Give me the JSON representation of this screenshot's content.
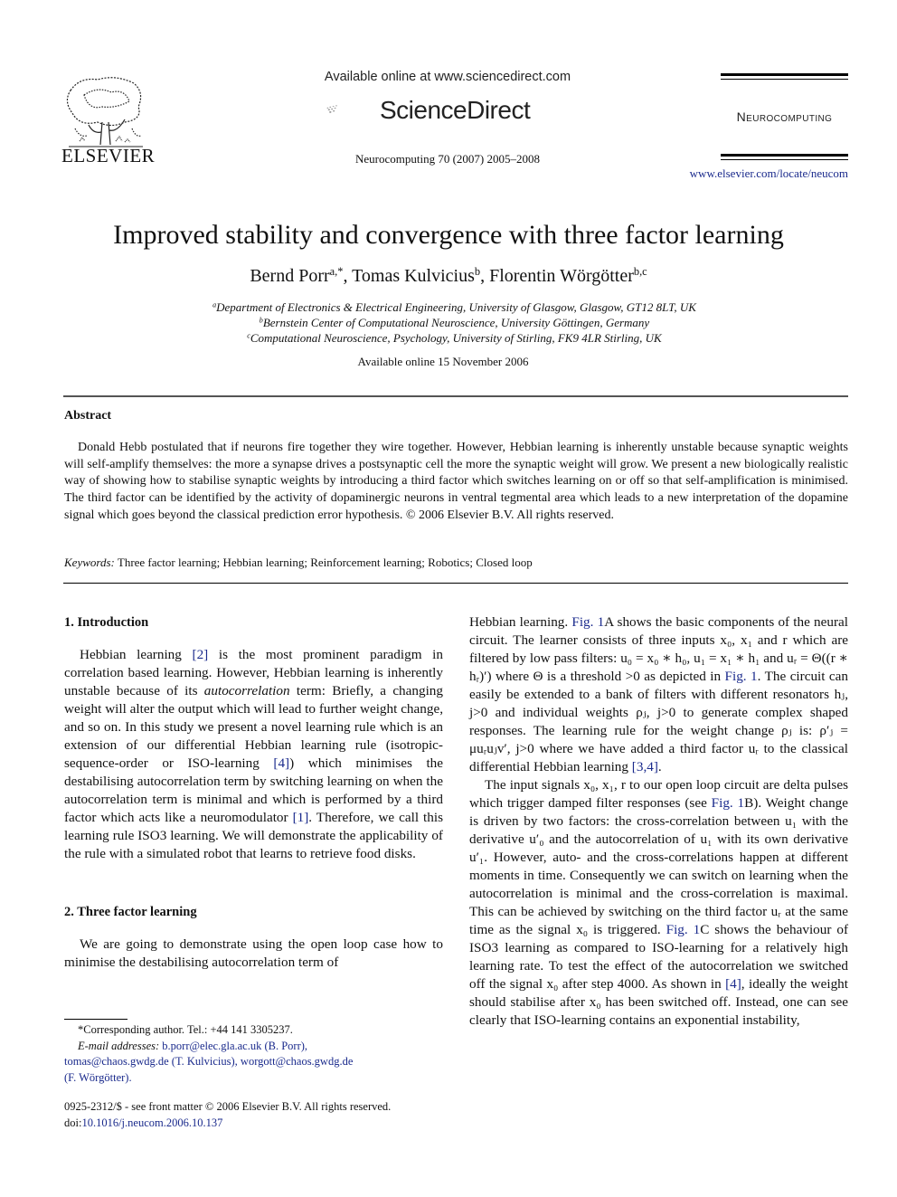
{
  "header": {
    "publisher_logo_word": "ELSEVIER",
    "sd_available": "Available online at www.sciencedirect.com",
    "sd_brand": "ScienceDirect",
    "journal_ref": "Neurocomputing 70 (2007) 2005–2008",
    "journal_name": "Neurocomputing",
    "journal_url": "www.elsevier.com/locate/neucom"
  },
  "article": {
    "title": "Improved stability and convergence with three factor learning",
    "authors": [
      {
        "name": "Bernd Porr",
        "sup": "a,*"
      },
      {
        "name": "Tomas Kulvicius",
        "sup": "b"
      },
      {
        "name": "Florentin Wörgötter",
        "sup": "b,c"
      }
    ],
    "author_sep": ", ",
    "affiliations": [
      {
        "sup": "a",
        "text": "Department of Electronics & Electrical Engineering, University of Glasgow, Glasgow, GT12 8LT, UK"
      },
      {
        "sup": "b",
        "text": "Bernstein Center of Computational Neuroscience, University Göttingen, Germany"
      },
      {
        "sup": "c",
        "text": "Computational Neuroscience, Psychology, University of Stirling, FK9 4LR Stirling, UK"
      }
    ],
    "available_online": "Available online 15 November 2006"
  },
  "abstract": {
    "heading": "Abstract",
    "text": "Donald Hebb postulated that if neurons fire together they wire together. However, Hebbian learning is inherently unstable because synaptic weights will self-amplify themselves: the more a synapse drives a postsynaptic cell the more the synaptic weight will grow. We present a new biologically realistic way of showing how to stabilise synaptic weights by introducing a third factor which switches learning on or off so that self-amplification is minimised. The third factor can be identified by the activity of dopaminergic neurons in ventral tegmental area which leads to a new interpretation of the dopamine signal which goes beyond the classical prediction error hypothesis.",
    "copyright": "© 2006 Elsevier B.V. All rights reserved.",
    "keywords_label": "Keywords:",
    "keywords": "Three factor learning; Hebbian learning; Reinforcement learning; Robotics; Closed loop"
  },
  "sections": {
    "intro_heading": "1.  Introduction",
    "intro": {
      "t1": "Hebbian learning ",
      "ref1": "[2]",
      "t2": " is the most prominent paradigm in correlation based learning. However, Hebbian learning is inherently unstable because of its ",
      "em1": "autocorrelation",
      "t3": " term: Briefly, a changing weight will alter the output which will lead to further weight change, and so on. In this study we present a novel learning rule which is an extension of our differential Hebbian learning rule (isotropic-sequence-order or ISO-learning ",
      "ref2": "[4]",
      "t4": ") which minimises the destabilising autocorrelation term by switching learning on when the autocorrelation term is minimal and which is performed by a third factor which acts like a neuromodulator ",
      "ref3": "[1]",
      "t5": ". Therefore, we call this learning rule ISO3 learning. We will demonstrate the applicability of the rule with a simulated robot that learns to retrieve food disks."
    },
    "tfl_heading": "2.  Three factor learning",
    "tfl_p1": {
      "t1": "We are going to demonstrate using the open loop case how to minimise the destabilising autocorrelation term of Hebbian learning. ",
      "ref1": "Fig. 1",
      "t2": "A shows the basic components of the neural circuit. The learner consists of three inputs x₀, x₁ and r which are filtered by low pass filters: u₀ = x₀ ∗ h₀, u₁ = x₁ ∗ h₁ and uᵣ = Θ((r ∗ hᵣ)′) where Θ is a threshold >0 as depicted in ",
      "ref2": "Fig. 1",
      "t3": ". The circuit can easily be extended to a bank of filters with different resonators hⱼ, j>0 and individual weights ρⱼ, j>0 to generate complex shaped responses. The learning rule for the weight change ρⱼ is: ρ′ⱼ = μuᵣuⱼv′, j>0 where we have added a third factor uᵣ to the classical differential Hebbian learning ",
      "ref3": "[3,4]",
      "t4": "."
    },
    "tfl_p2": {
      "t1": "The input signals x₀, x₁, r to our open loop circuit are delta pulses which trigger damped filter responses (see ",
      "ref1": "Fig. 1",
      "t2": "B). Weight change is driven by two factors: the cross-correlation between u₁ with the derivative u′₀ and the autocorrelation of u₁ with its own derivative u′₁. However, auto- and the cross-correlations happen at different moments in time. Consequently we can switch on learning when the autocorrelation is minimal and the cross-correlation is maximal. This can be achieved by switching on the third factor uᵣ at the same time as the signal x₀ is triggered. ",
      "ref2": "Fig. 1",
      "t3": "C shows the behaviour of ISO3 learning as compared to ISO-learning for a relatively high learning rate. To test the effect of the autocorrelation we switched off the signal x₀ after step 4000. As shown in ",
      "ref3": "[4]",
      "t4": ", ideally the weight should stabilise after x₀ has been switched off. Instead, one can see clearly that ISO-learning contains an exponential instability,"
    }
  },
  "footnotes": {
    "corresponding": "*Corresponding author. Tel.: +44 141 3305237.",
    "email_label": "E-mail addresses:",
    "email1": "b.porr@elec.gla.ac.uk (B. Porr),",
    "email2": "tomas@chaos.gwdg.de (T. Kulvicius),",
    "email3": "worgott@chaos.gwdg.de",
    "email3_name": "(F. Wörgötter).",
    "front_matter": "0925-2312/$ - see front matter © 2006 Elsevier B.V. All rights reserved.",
    "doi_label": "doi:",
    "doi": "10.1016/j.neucom.2006.10.137"
  },
  "colors": {
    "link": "#1a2a8c",
    "text": "#111111"
  }
}
